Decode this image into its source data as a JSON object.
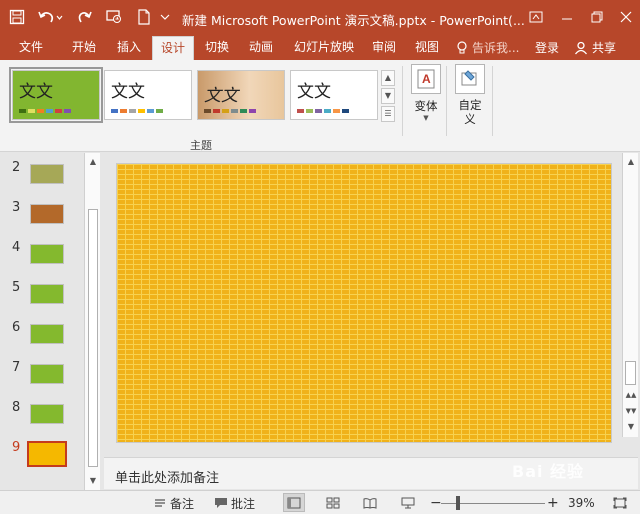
{
  "title_bar": {
    "title": "新建 Microsoft PowerPoint 演示文稿.pptx - PowerPoint(..."
  },
  "ribbon_tabs": [
    "文件",
    "开始",
    "插入",
    "设计",
    "切换",
    "动画",
    "幻灯片放映",
    "审阅",
    "视图"
  ],
  "active_tab": "设计",
  "tell_me": "告诉我...",
  "login": "登录",
  "share": "共享",
  "themes": {
    "group_label": "主题",
    "items": [
      {
        "label": "文文",
        "background": "#82b630",
        "text_color": "#2a2a2a"
      },
      {
        "label": "文文",
        "background": "#ffffff",
        "text_color": "#2a2a2a"
      },
      {
        "label": "文文",
        "background": "#d6b08a",
        "text_color": "#2a2a2a"
      },
      {
        "label": "文文",
        "background": "#ffffff",
        "text_color": "#2a2a2a"
      }
    ]
  },
  "variants_label": "变体",
  "customize_label": "自定\n义",
  "slides": [
    {
      "number": "2",
      "color": "#a6a857"
    },
    {
      "number": "3",
      "color": "#b3692a"
    },
    {
      "number": "4",
      "color": "#84b92e"
    },
    {
      "number": "5",
      "color": "#84b92e"
    },
    {
      "number": "6",
      "color": "#84b92e"
    },
    {
      "number": "7",
      "color": "#84b92e"
    },
    {
      "number": "8",
      "color": "#84b92e"
    },
    {
      "number": "9",
      "color": "#f5b800"
    }
  ],
  "current_slide": "9",
  "notes_placeholder": "单击此处添加备注",
  "status_bar": {
    "notes": "备注",
    "comments": "批注",
    "zoom": "39%"
  },
  "watermark": "Bai 经验",
  "colors": {
    "accent": "#b7472a",
    "slide_fill": "#f0b21a"
  }
}
